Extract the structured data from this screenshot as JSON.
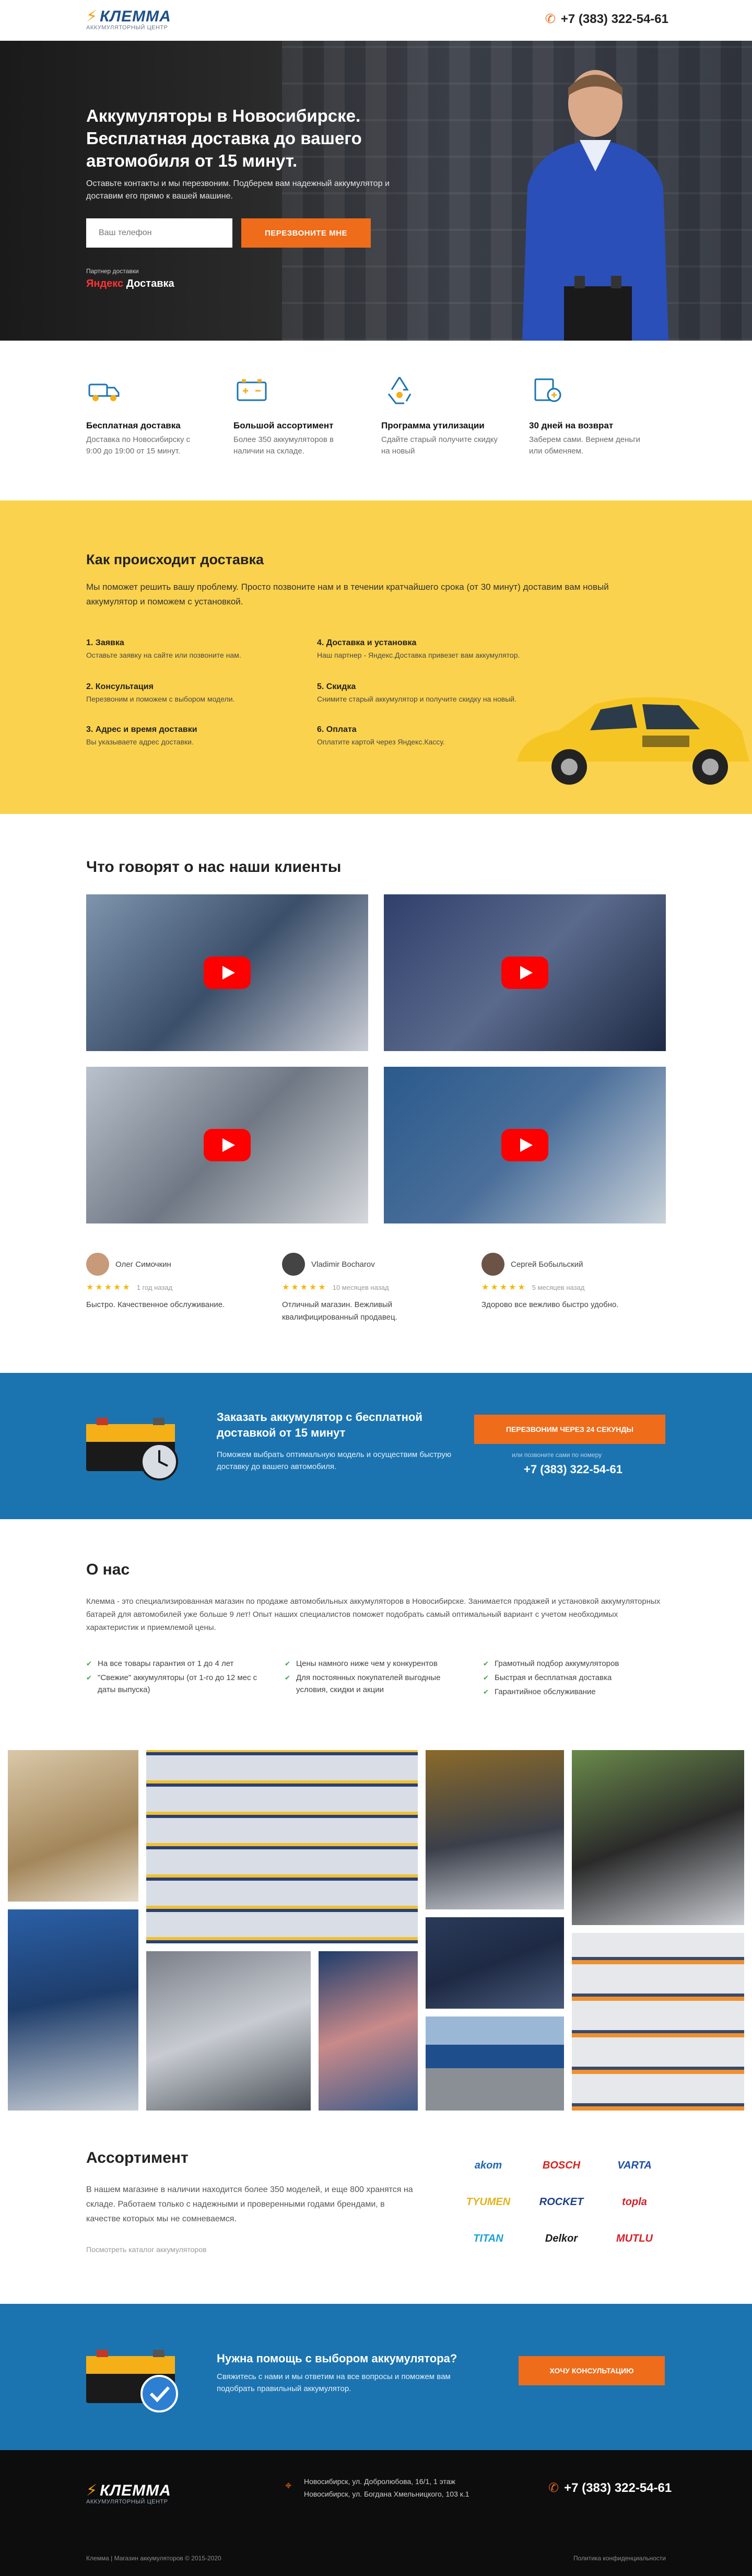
{
  "header": {
    "logo_text": "КЛЕММА",
    "logo_sub": "АККУМУЛЯТОРНЫЙ ЦЕНТР",
    "phone": "+7 (383) 322-54-61"
  },
  "hero": {
    "title": "Аккумуляторы в Новосибирске. Бесплатная доставка до вашего автомобиля от 15 минут.",
    "subtitle": "Оставьте контакты и мы перезвоним. Подберем вам надежный аккумулятор и доставим его прямо к вашей машине.",
    "phone_placeholder": "Ваш телефон",
    "call_button": "Перезвоните мне",
    "partner_label": "Партнер доставки",
    "partner_logo_a": "Яндекс",
    "partner_logo_b": " Доставка"
  },
  "features": [
    {
      "icon": "delivery-truck-icon",
      "title": "Бесплатная доставка",
      "text": "Доставка по Новосибирску с 9:00 до 19:00 от 15 минут."
    },
    {
      "icon": "battery-icon",
      "title": "Большой ассортимент",
      "text": "Более 350 аккумуляторов в наличии на складе."
    },
    {
      "icon": "recycle-icon",
      "title": "Программа утилизации",
      "text": "Сдайте старый получите скидку на новый"
    },
    {
      "icon": "return-box-icon",
      "title": "30 дней на возврат",
      "text": "Заберем сами. Вернем деньги или обменяем."
    }
  ],
  "delivery": {
    "title": "Как происходит доставка",
    "intro": "Мы поможет решить вашу проблему. Просто позвоните нам и в течении кратчайшего срока (от 30 минут) доставим вам новый аккумулятор и поможем с установкой.",
    "steps": [
      {
        "title": "1. Заявка",
        "text": "Оставьте заявку на сайте или позвоните нам."
      },
      {
        "title": "2. Консультация",
        "text": "Перезвоним и поможем с выбором модели."
      },
      {
        "title": "3. Адрес и время доставки",
        "text": "Вы указываете адрес доставки."
      },
      {
        "title": "4. Доставка и установка",
        "text": "Наш партнер - Яндекс.Доставка привезет вам аккумулятор."
      },
      {
        "title": "5. Скидка",
        "text": "Снимите старый аккумулятор и получите скидку на новый."
      },
      {
        "title": "6. Оплата",
        "text": "Оплатите картой через Яндекс.Кассу."
      }
    ]
  },
  "reviews": {
    "title": "Что говорят о нас наши клиенты",
    "items": [
      {
        "name": "Олег Симочкин",
        "date": "1 год назад",
        "stars": 5,
        "text": "Быстро. Качественное обслуживание."
      },
      {
        "name": "Vladimir Bocharov",
        "date": "10 месяцев назад",
        "stars": 5,
        "text": "Отличный магазин. Вежливый квалифицированный продавец."
      },
      {
        "name": "Сергей Бобыльский",
        "date": "5 месяцев назад",
        "stars": 5,
        "text": "Здорово все вежливо быстро удобно."
      }
    ]
  },
  "cta1": {
    "title": "Заказать аккумулятор с бесплатной доставкой от 15 минут",
    "text": "Поможем выбрать оптимальную модель и осуществим быструю доставку до вашего автомобиля.",
    "button": "Перезвоним через 24 секунды",
    "or_call": "или позвоните сами по номеру",
    "phone": "+7 (383) 322-54-61"
  },
  "about": {
    "title": "О нас",
    "text": "Клемма - это специализированная магазин по продаже автомобильных аккумуляторов в Новосибирске. Занимается продажей и установкой аккумуляторных батарей для автомобилей уже больше 9 лет! Опыт наших специалистов поможет подобрать самый оптимальный вариант с учетом необходимых характеристик и приемлемой цены.",
    "col1": [
      "На все товары гарантия от 1 до 4 лет",
      "\"Свежие\" аккумуляторы (от 1-го до 12 мес с даты выпуска)"
    ],
    "col2": [
      "Цены намного ниже чем у конкурентов",
      "Для постоянных покупателей выгодные условия, скидки и акции"
    ],
    "col3": [
      "Грамотный подбор аккумуляторов",
      "Быстрая и бесплатная доставка",
      "Гарантийное обслуживание"
    ]
  },
  "assortment": {
    "title": "Ассортимент",
    "text": "В нашем магазине в наличии находится более 350 моделей, и еще 800 хранятся на складе. Работаем только с надежными и проверенными годами брендами, в качестве которых мы не сомневаемся.",
    "link": "Посмотреть каталог аккумуляторов",
    "brands": [
      "akom",
      "BOSCH",
      "VARTA",
      "TYUMEN",
      "ROCKET",
      "topla",
      "TITAN",
      "Delkor",
      "MUTLU"
    ],
    "brand_colors": [
      "#1f66b0",
      "#d6231f",
      "#1f4fa8",
      "#e3b21c",
      "#1c3f86",
      "#d21f2a",
      "#1fa0d8",
      "#1a1a1a",
      "#d61f26"
    ]
  },
  "cta2": {
    "title": "Нужна помощь с выбором аккумулятора?",
    "text": "Свяжитесь с нами и мы ответим на все вопросы и поможем вам подобрать правильный аккумулятор.",
    "button": "Хочу консультацию"
  },
  "footer": {
    "addr1": "Новосибирск, ул. Добролюбова, 16/1, 1 этаж",
    "addr2": "Новосибирск, ул. Богдана Хмельницкого, 103 к.1",
    "phone": "+7 (383) 322-54-61",
    "copyright": "Клемма | Магазин аккумуляторов © 2015-2020",
    "policy": "Политика конфиденциальности"
  },
  "colors": {
    "accent": "#ef6c1a",
    "brand_blue": "#1b74b0",
    "yellow": "#fbd24d"
  }
}
